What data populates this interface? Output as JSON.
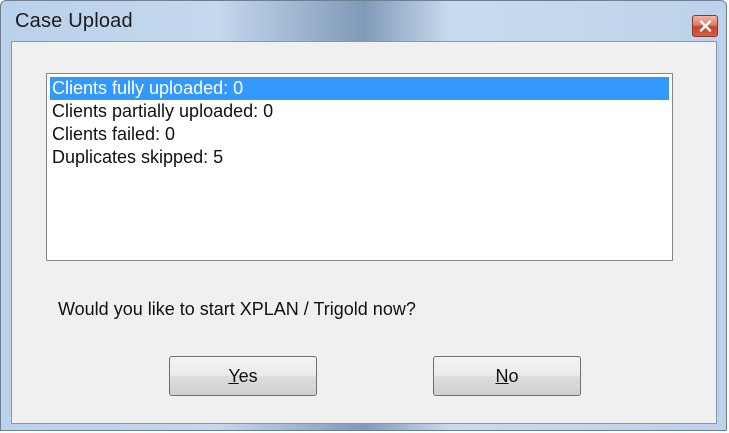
{
  "window": {
    "title": "Case Upload"
  },
  "results": {
    "items": [
      {
        "label": "Clients fully uploaded: 0",
        "selected": true
      },
      {
        "label": "Clients partially uploaded: 0",
        "selected": false
      },
      {
        "label": "Clients failed: 0",
        "selected": false
      },
      {
        "label": "Duplicates skipped: 5",
        "selected": false
      }
    ]
  },
  "prompt": {
    "question": "Would you like to start XPLAN / Trigold now?"
  },
  "buttons": {
    "yes_mnemonic": "Y",
    "yes_rest": "es",
    "no_mnemonic": "N",
    "no_rest": "o"
  },
  "colors": {
    "selection": "#3399ff",
    "close_button": "#c7432a",
    "dialog_background": "#f0f0f0"
  },
  "icons": {
    "close": "close-icon"
  }
}
